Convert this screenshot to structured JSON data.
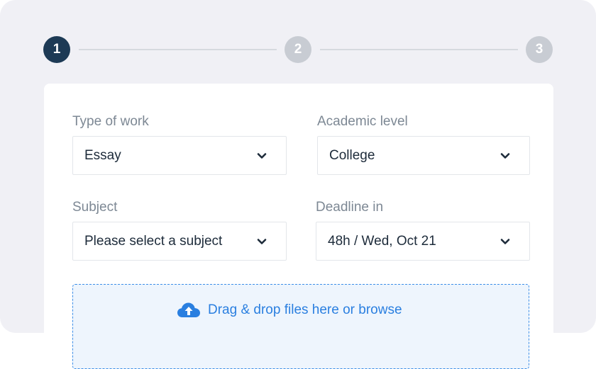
{
  "stepper": {
    "steps": [
      {
        "number": "1",
        "state": "active"
      },
      {
        "number": "2",
        "state": "inactive"
      },
      {
        "number": "3",
        "state": "inactive"
      }
    ]
  },
  "form": {
    "type_of_work": {
      "label": "Type of work",
      "value": "Essay"
    },
    "academic_level": {
      "label": "Academic level",
      "value": "College"
    },
    "subject": {
      "label": "Subject",
      "value": "Please select a subject"
    },
    "deadline": {
      "label": "Deadline in",
      "value": "48h / Wed, Oct 21"
    }
  },
  "upload": {
    "text": "Drag & drop files here or browse",
    "icon": "cloud-upload-icon"
  },
  "colors": {
    "step_active": "#1d3a55",
    "step_inactive": "#c8ccd3",
    "accent_blue": "#2a7fe0",
    "dropzone_bg": "#eef5fd"
  }
}
